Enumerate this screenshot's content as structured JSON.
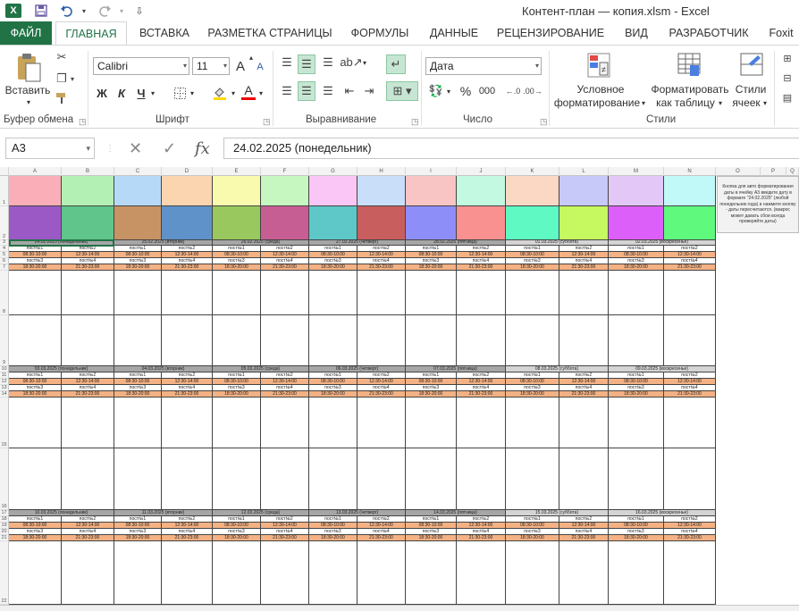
{
  "title": "Контент-план — копия.xlsm - Excel",
  "quick_access": {
    "logo": "X"
  },
  "tabs": [
    {
      "label": "ФАЙЛ"
    },
    {
      "label": "ГЛАВНАЯ"
    },
    {
      "label": "ВСТАВКА"
    },
    {
      "label": "РАЗМЕТКА СТРАНИЦЫ"
    },
    {
      "label": "ФОРМУЛЫ"
    },
    {
      "label": "ДАННЫЕ"
    },
    {
      "label": "РЕЦЕНЗИРОВАНИЕ"
    },
    {
      "label": "ВИД"
    },
    {
      "label": "РАЗРАБОТЧИК"
    },
    {
      "label": "Foxit"
    }
  ],
  "ribbon": {
    "clipboard": {
      "paste": "Вставить",
      "group": "Буфер обмена"
    },
    "font": {
      "name": "Calibri",
      "size": "11",
      "bold": "Ж",
      "italic": "К",
      "underline": "Ч",
      "group": "Шрифт",
      "grow": "A",
      "shrink": "A",
      "font_color": "A"
    },
    "alignment": {
      "group": "Выравнивание"
    },
    "number": {
      "format": "Дата",
      "percent": "%",
      "thousands": "000",
      "group": "Число"
    },
    "styles": {
      "conditional": "Условное\nформатирование",
      "cond_line1": "Условное",
      "cond_line2": "форматирование",
      "table_line1": "Форматировать",
      "table_line2": "как таблицу",
      "cell_line1": "Стили",
      "cell_line2": "ячеек",
      "group": "Стили"
    }
  },
  "formula_bar": {
    "name_box": "A3",
    "fx": "fx",
    "formula": "24.02.2025 (понедельник)"
  },
  "sheet": {
    "columns": [
      "A",
      "B",
      "C",
      "D",
      "E",
      "F",
      "G",
      "H",
      "I",
      "J",
      "K",
      "L",
      "M",
      "N",
      "O",
      "P",
      "Q"
    ],
    "rows": [
      "1",
      "2",
      "3",
      "4",
      "5",
      "6",
      "7",
      "8",
      "9",
      "10",
      "11",
      "12",
      "13",
      "14",
      "15",
      "16",
      "17",
      "18",
      "19",
      "20",
      "21",
      "22"
    ],
    "swatches_top": [
      "#f9aeb8",
      "#b3f0b3",
      "#b6d9f7",
      "#fbd5b0",
      "#fafaae",
      "#c7f7c0",
      "#f9c6f5",
      "#c9def9",
      "#f9c4c4",
      "#c2f9e0",
      "#fbd8c3",
      "#c7c9f9",
      "#e3c7f7",
      "#c1f9f9"
    ],
    "swatches_bottom": [
      "#9b59c6",
      "#5fc58a",
      "#c89364",
      "#5e92c9",
      "#99c85f",
      "#c75e93",
      "#5ec7c8",
      "#c95e5e",
      "#8e8ef9",
      "#fa9191",
      "#5ff9c4",
      "#c6f95f",
      "#dc5ff9",
      "#5ff97e"
    ],
    "weeks": [
      {
        "dates": [
          "24.02.2025 (понедельник)",
          "25.02.2025 (вторник)",
          "26.02.2025 (среда)",
          "27.02.2025 (четверг)",
          "28.02.2025 (пятница)",
          "01.03.2025 (суббота)",
          "02.03.2025 (воскресенье)"
        ]
      },
      {
        "dates": [
          "03.03.2025 (понедельник)",
          "04.03.2025 (вторник)",
          "05.03.2025 (среда)",
          "06.03.2025 (четверг)",
          "07.03.2025 (пятница)",
          "08.03.2025 (суббота)",
          "09.03.2025 (воскресенье)"
        ]
      },
      {
        "dates": [
          "10.03.2025 (понедельник)",
          "11.03.2025 (вторник)",
          "12.03.2025 (среда)",
          "13.03.2025 (четверг)",
          "14.03.2025 (пятница)",
          "15.03.2025 (суббота)",
          "16.03.2025 (воскресенье)"
        ]
      }
    ],
    "slot_rows": [
      [
        "пост№1",
        "пост№2"
      ],
      [
        "08:30-10:00",
        "12:30-14:00"
      ],
      [
        "пост№3",
        "пост№4"
      ],
      [
        "18:30-20:00",
        "21:30-23:00"
      ]
    ],
    "note": "Кнопка для авто форматирования даты в ячейку А3 введите дату в формате \"24.02.2025\" (любой понедельник года) и нажмите кнопку - даты пересчитаются. (макрос может давать сбои всегда проверяйте даты)"
  },
  "colors": {
    "accent": "#217346",
    "date_header": "#a6a6a6",
    "time_slot": "#f4b183"
  }
}
